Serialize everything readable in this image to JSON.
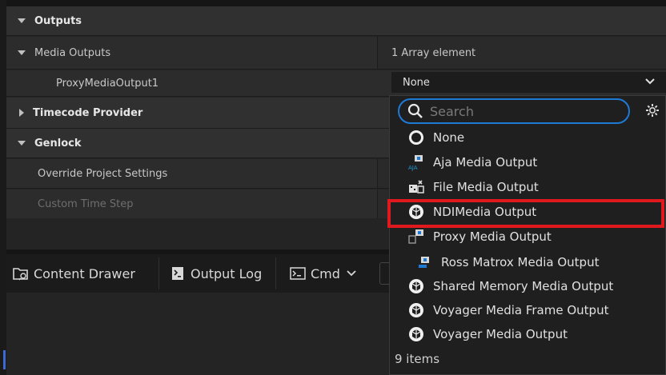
{
  "details": {
    "outputs_label": "Outputs",
    "media_outputs_label": "Media Outputs",
    "media_outputs_value": "1 Array element",
    "proxy_label": "ProxyMediaOutput1",
    "proxy_value": "None",
    "timecode_label": "Timecode Provider",
    "genlock_label": "Genlock",
    "override_label": "Override Project Settings",
    "custom_time_label": "Custom Time Step"
  },
  "toolbar": {
    "content_drawer": "Content Drawer",
    "output_log": "Output Log",
    "cmd": "Cmd"
  },
  "menu": {
    "search_placeholder": "Search",
    "items": [
      {
        "label": "None",
        "icon": "circle-none-icon"
      },
      {
        "label": "Aja Media Output",
        "icon": "aja-icon"
      },
      {
        "label": "File Media Output",
        "icon": "file-media-icon"
      },
      {
        "label": "NDIMedia Output",
        "icon": "unreal-cube-icon"
      },
      {
        "label": "Proxy Media Output",
        "icon": "proxy-icon"
      },
      {
        "label": "Ross Matrox Media Output",
        "icon": "ross-icon"
      },
      {
        "label": "Shared Memory Media Output",
        "icon": "unreal-cube-icon"
      },
      {
        "label": "Voyager Media Frame Output",
        "icon": "unreal-cube-icon"
      },
      {
        "label": "Voyager Media Output",
        "icon": "unreal-cube-icon"
      }
    ],
    "count": "9 items"
  },
  "colors": {
    "accent": "#1f7ad6",
    "highlight": "#e0191e"
  }
}
